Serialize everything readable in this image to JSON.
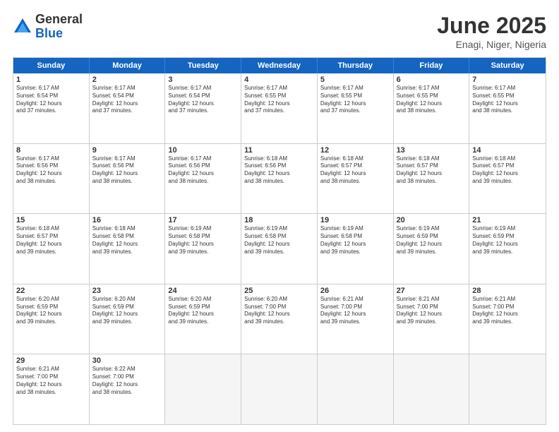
{
  "logo": {
    "general": "General",
    "blue": "Blue"
  },
  "title": "June 2025",
  "subtitle": "Enagi, Niger, Nigeria",
  "header_days": [
    "Sunday",
    "Monday",
    "Tuesday",
    "Wednesday",
    "Thursday",
    "Friday",
    "Saturday"
  ],
  "weeks": [
    [
      {
        "day": "1",
        "lines": [
          "Sunrise: 6:17 AM",
          "Sunset: 6:54 PM",
          "Daylight: 12 hours",
          "and 37 minutes."
        ]
      },
      {
        "day": "2",
        "lines": [
          "Sunrise: 6:17 AM",
          "Sunset: 6:54 PM",
          "Daylight: 12 hours",
          "and 37 minutes."
        ]
      },
      {
        "day": "3",
        "lines": [
          "Sunrise: 6:17 AM",
          "Sunset: 6:54 PM",
          "Daylight: 12 hours",
          "and 37 minutes."
        ]
      },
      {
        "day": "4",
        "lines": [
          "Sunrise: 6:17 AM",
          "Sunset: 6:55 PM",
          "Daylight: 12 hours",
          "and 37 minutes."
        ]
      },
      {
        "day": "5",
        "lines": [
          "Sunrise: 6:17 AM",
          "Sunset: 6:55 PM",
          "Daylight: 12 hours",
          "and 37 minutes."
        ]
      },
      {
        "day": "6",
        "lines": [
          "Sunrise: 6:17 AM",
          "Sunset: 6:55 PM",
          "Daylight: 12 hours",
          "and 38 minutes."
        ]
      },
      {
        "day": "7",
        "lines": [
          "Sunrise: 6:17 AM",
          "Sunset: 6:55 PM",
          "Daylight: 12 hours",
          "and 38 minutes."
        ]
      }
    ],
    [
      {
        "day": "8",
        "lines": [
          "Sunrise: 6:17 AM",
          "Sunset: 6:56 PM",
          "Daylight: 12 hours",
          "and 38 minutes."
        ]
      },
      {
        "day": "9",
        "lines": [
          "Sunrise: 6:17 AM",
          "Sunset: 6:56 PM",
          "Daylight: 12 hours",
          "and 38 minutes."
        ]
      },
      {
        "day": "10",
        "lines": [
          "Sunrise: 6:17 AM",
          "Sunset: 6:56 PM",
          "Daylight: 12 hours",
          "and 38 minutes."
        ]
      },
      {
        "day": "11",
        "lines": [
          "Sunrise: 6:18 AM",
          "Sunset: 6:56 PM",
          "Daylight: 12 hours",
          "and 38 minutes."
        ]
      },
      {
        "day": "12",
        "lines": [
          "Sunrise: 6:18 AM",
          "Sunset: 6:57 PM",
          "Daylight: 12 hours",
          "and 38 minutes."
        ]
      },
      {
        "day": "13",
        "lines": [
          "Sunrise: 6:18 AM",
          "Sunset: 6:57 PM",
          "Daylight: 12 hours",
          "and 38 minutes."
        ]
      },
      {
        "day": "14",
        "lines": [
          "Sunrise: 6:18 AM",
          "Sunset: 6:57 PM",
          "Daylight: 12 hours",
          "and 39 minutes."
        ]
      }
    ],
    [
      {
        "day": "15",
        "lines": [
          "Sunrise: 6:18 AM",
          "Sunset: 6:57 PM",
          "Daylight: 12 hours",
          "and 39 minutes."
        ]
      },
      {
        "day": "16",
        "lines": [
          "Sunrise: 6:18 AM",
          "Sunset: 6:58 PM",
          "Daylight: 12 hours",
          "and 39 minutes."
        ]
      },
      {
        "day": "17",
        "lines": [
          "Sunrise: 6:19 AM",
          "Sunset: 6:58 PM",
          "Daylight: 12 hours",
          "and 39 minutes."
        ]
      },
      {
        "day": "18",
        "lines": [
          "Sunrise: 6:19 AM",
          "Sunset: 6:58 PM",
          "Daylight: 12 hours",
          "and 39 minutes."
        ]
      },
      {
        "day": "19",
        "lines": [
          "Sunrise: 6:19 AM",
          "Sunset: 6:58 PM",
          "Daylight: 12 hours",
          "and 39 minutes."
        ]
      },
      {
        "day": "20",
        "lines": [
          "Sunrise: 6:19 AM",
          "Sunset: 6:59 PM",
          "Daylight: 12 hours",
          "and 39 minutes."
        ]
      },
      {
        "day": "21",
        "lines": [
          "Sunrise: 6:19 AM",
          "Sunset: 6:59 PM",
          "Daylight: 12 hours",
          "and 39 minutes."
        ]
      }
    ],
    [
      {
        "day": "22",
        "lines": [
          "Sunrise: 6:20 AM",
          "Sunset: 6:59 PM",
          "Daylight: 12 hours",
          "and 39 minutes."
        ]
      },
      {
        "day": "23",
        "lines": [
          "Sunrise: 6:20 AM",
          "Sunset: 6:59 PM",
          "Daylight: 12 hours",
          "and 39 minutes."
        ]
      },
      {
        "day": "24",
        "lines": [
          "Sunrise: 6:20 AM",
          "Sunset: 6:59 PM",
          "Daylight: 12 hours",
          "and 39 minutes."
        ]
      },
      {
        "day": "25",
        "lines": [
          "Sunrise: 6:20 AM",
          "Sunset: 7:00 PM",
          "Daylight: 12 hours",
          "and 39 minutes."
        ]
      },
      {
        "day": "26",
        "lines": [
          "Sunrise: 6:21 AM",
          "Sunset: 7:00 PM",
          "Daylight: 12 hours",
          "and 39 minutes."
        ]
      },
      {
        "day": "27",
        "lines": [
          "Sunrise: 6:21 AM",
          "Sunset: 7:00 PM",
          "Daylight: 12 hours",
          "and 39 minutes."
        ]
      },
      {
        "day": "28",
        "lines": [
          "Sunrise: 6:21 AM",
          "Sunset: 7:00 PM",
          "Daylight: 12 hours",
          "and 39 minutes."
        ]
      }
    ],
    [
      {
        "day": "29",
        "lines": [
          "Sunrise: 6:21 AM",
          "Sunset: 7:00 PM",
          "Daylight: 12 hours",
          "and 38 minutes."
        ]
      },
      {
        "day": "30",
        "lines": [
          "Sunrise: 6:22 AM",
          "Sunset: 7:00 PM",
          "Daylight: 12 hours",
          "and 38 minutes."
        ]
      },
      {
        "day": "",
        "lines": [],
        "empty": true
      },
      {
        "day": "",
        "lines": [],
        "empty": true
      },
      {
        "day": "",
        "lines": [],
        "empty": true
      },
      {
        "day": "",
        "lines": [],
        "empty": true
      },
      {
        "day": "",
        "lines": [],
        "empty": true
      }
    ]
  ]
}
